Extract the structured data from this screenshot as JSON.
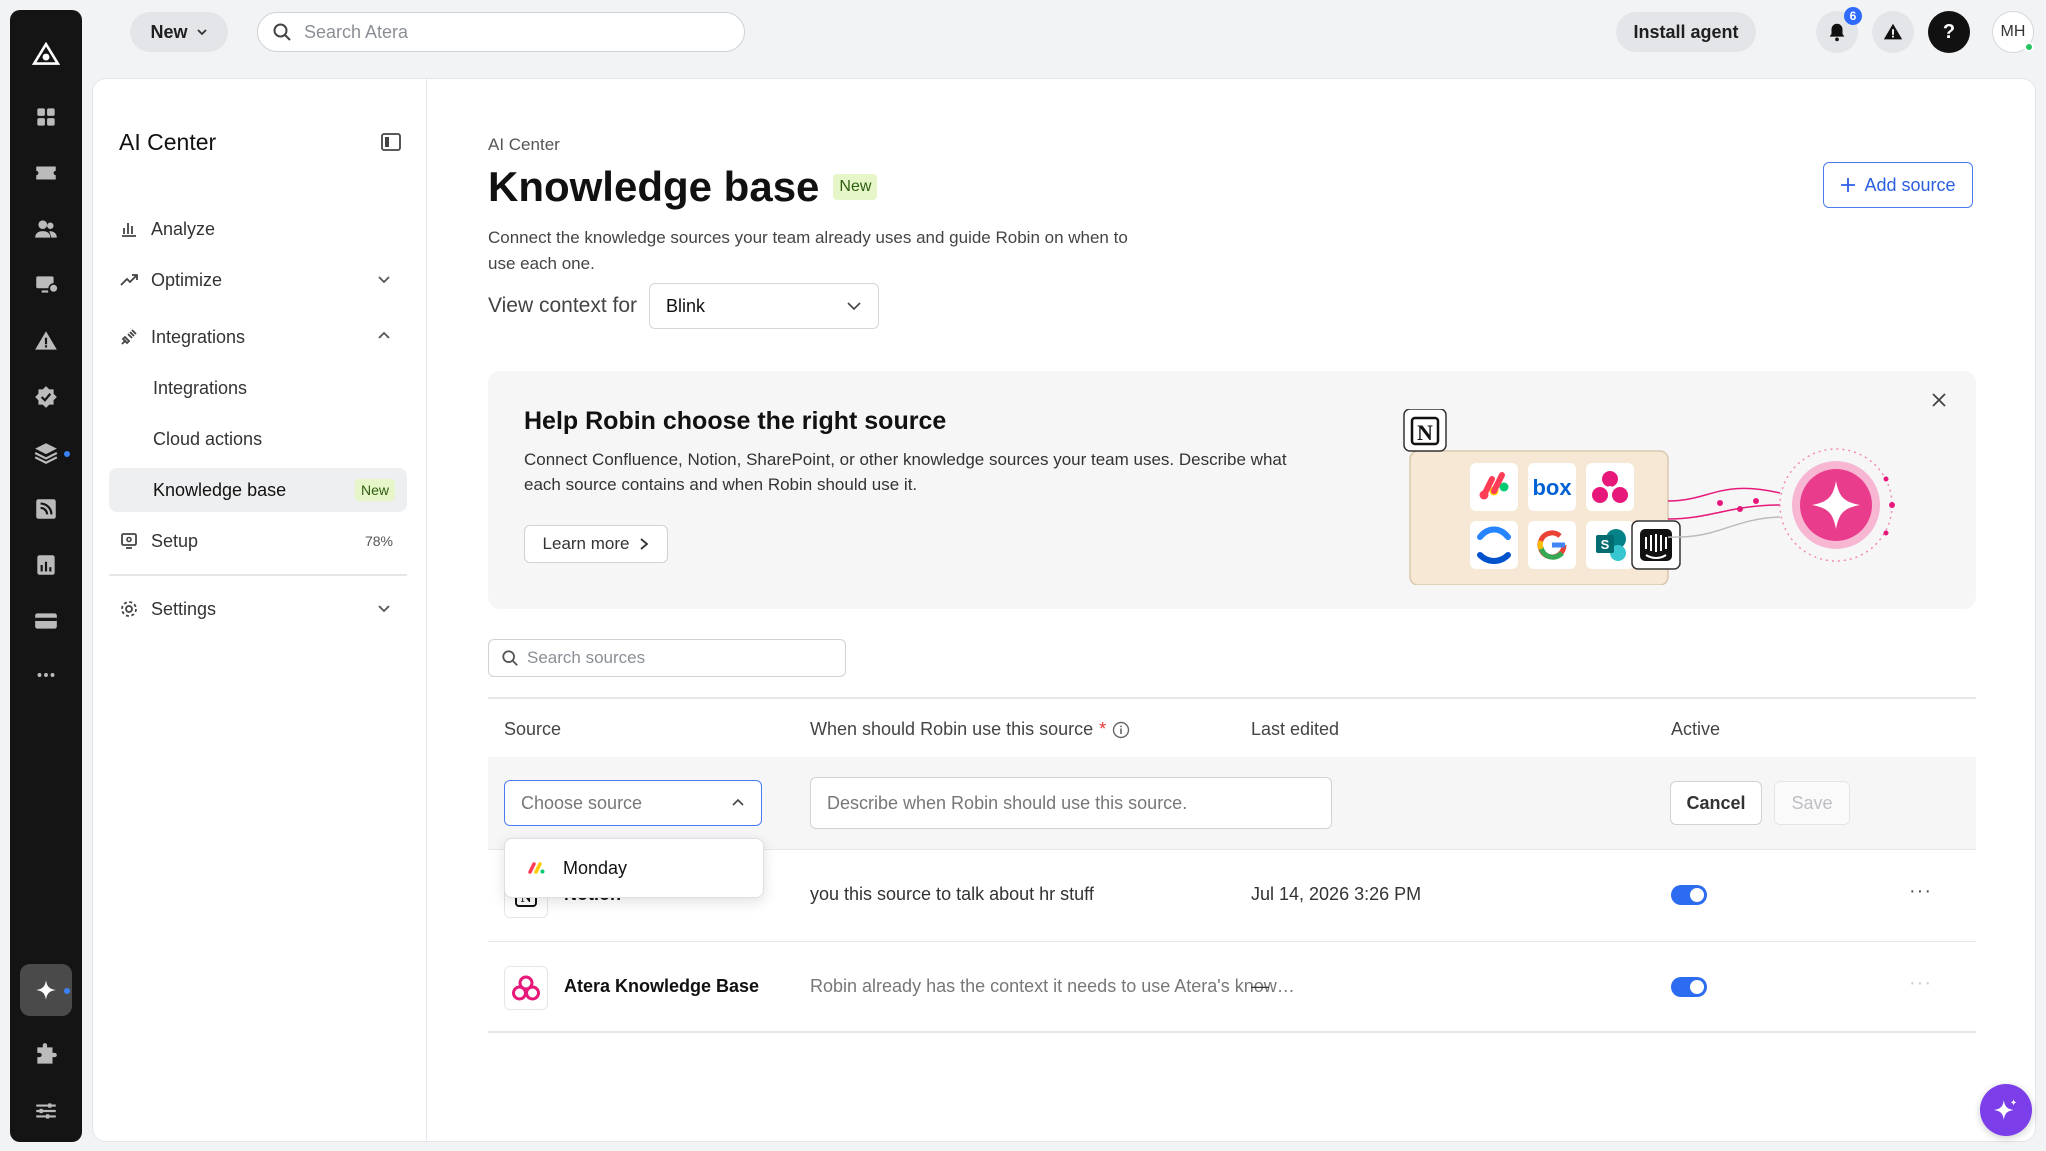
{
  "topbar": {
    "new_label": "New",
    "search_placeholder": "Search Atera",
    "install_label": "Install agent",
    "notifications_count": "6",
    "help_label": "?",
    "avatar_initials": "MH"
  },
  "rail": {
    "items": [
      "logo-icon",
      "dashboard-icon",
      "tickets-icon",
      "customers-icon",
      "devices-icon",
      "alerts-icon",
      "patch-icon",
      "layers-icon",
      "feeds-icon",
      "reports-icon",
      "billing-icon",
      "more-icon",
      "ai-icon",
      "extensions-icon",
      "settings-sliders-icon"
    ],
    "active": "ai-icon"
  },
  "sidenav": {
    "title": "AI Center",
    "items": [
      {
        "label": "Analyze"
      },
      {
        "label": "Optimize"
      },
      {
        "label": "Integrations"
      },
      {
        "label": "Integrations"
      },
      {
        "label": "Cloud actions"
      },
      {
        "label": "Knowledge base",
        "badge": "New"
      },
      {
        "label": "Setup",
        "progress": "78%"
      },
      {
        "label": "Settings"
      }
    ]
  },
  "page": {
    "breadcrumb": "AI Center",
    "title": "Knowledge base",
    "title_badge": "New",
    "description": "Connect the knowledge sources your team already uses and guide Robin on when to use each one.",
    "context_label": "View context for",
    "context_value": "Blink",
    "add_source_label": "Add source"
  },
  "banner": {
    "title": "Help Robin choose the right source",
    "body": "Connect Confluence, Notion, SharePoint, or other knowledge sources your team uses. Describe what each source contains and when Robin should use it.",
    "learn_more": "Learn more",
    "logo_labels": {
      "box": "box",
      "sharepoint": "S"
    }
  },
  "table": {
    "search_placeholder": "Search sources",
    "headers": {
      "source": "Source",
      "when": "When should Robin use this source",
      "required_mark": "*",
      "last_edited": "Last edited",
      "active": "Active"
    },
    "new_row": {
      "choose_placeholder": "Choose source",
      "describe_placeholder": "Describe when Robin should use this source.",
      "cancel": "Cancel",
      "save": "Save"
    },
    "dropdown_option": "Monday",
    "rows": [
      {
        "name": "Notion",
        "when": "you this source to talk about hr stuff",
        "edited": "Jul 14, 2026 3:26 PM",
        "active": true
      },
      {
        "name": "Atera Knowledge Base",
        "when": "Robin already has the context it needs to use Atera's know…",
        "edited": "—",
        "active": true
      }
    ]
  },
  "colors": {
    "accent": "#2b6cf0",
    "badge_green_bg": "#e6f6c8",
    "robin_pink": "#e6197a",
    "fab_purple": "#7b3ee8"
  }
}
